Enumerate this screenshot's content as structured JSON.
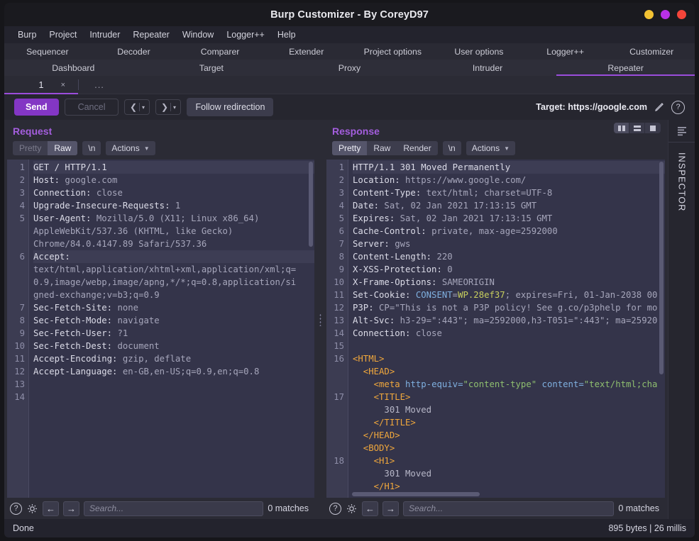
{
  "window": {
    "title": "Burp Customizer - By CoreyD97",
    "buttons": [
      {
        "name": "minimize",
        "color": "#f2c233"
      },
      {
        "name": "maximize",
        "color": "#b830e8"
      },
      {
        "name": "close",
        "color": "#f4453a"
      }
    ]
  },
  "menubar": {
    "items": [
      "Burp",
      "Project",
      "Intruder",
      "Repeater",
      "Window",
      "Logger++",
      "Help"
    ]
  },
  "nav": {
    "row1": [
      "Sequencer",
      "Decoder",
      "Comparer",
      "Extender",
      "Project options",
      "User options",
      "Logger++",
      "Customizer"
    ],
    "row2": [
      "Dashboard",
      "Target",
      "Proxy",
      "Intruder",
      "Repeater"
    ],
    "active_row2": "Repeater"
  },
  "repeater_tabs": {
    "tabs": [
      {
        "label": "1",
        "close": "×",
        "active": true
      }
    ],
    "more": "..."
  },
  "toolbar": {
    "send_label": "Send",
    "cancel_label": "Cancel",
    "back_caret": "▾",
    "forward_caret": "▾",
    "follow_label": "Follow redirection",
    "target_label": "Target: https://google.com",
    "edit_icon": "pencil-icon",
    "help_icon": "?"
  },
  "request": {
    "title": "Request",
    "tabs": [
      {
        "label": "Pretty",
        "state": "dim"
      },
      {
        "label": "Raw",
        "state": "on"
      }
    ],
    "newline_chip": "\\n",
    "actions_chip": "Actions",
    "lines": [
      {
        "n": "1",
        "hl": true,
        "segs": [
          {
            "t": "GET / HTTP/1.1",
            "c": "hk"
          }
        ]
      },
      {
        "n": "2",
        "hl": false,
        "segs": [
          {
            "t": "Host: ",
            "c": "hk"
          },
          {
            "t": "google.com",
            "c": "hv"
          }
        ]
      },
      {
        "n": "3",
        "hl": false,
        "segs": [
          {
            "t": "Connection: ",
            "c": "hk"
          },
          {
            "t": "close",
            "c": "hv"
          }
        ]
      },
      {
        "n": "4",
        "hl": false,
        "segs": [
          {
            "t": "Upgrade-Insecure-Requests: ",
            "c": "hk"
          },
          {
            "t": "1",
            "c": "hv"
          }
        ]
      },
      {
        "n": "5",
        "hl": false,
        "segs": [
          {
            "t": "User-Agent: ",
            "c": "hk"
          },
          {
            "t": "Mozilla/5.0 (X11; Linux x86_64)",
            "c": "hv"
          }
        ]
      },
      {
        "n": "",
        "hl": false,
        "segs": [
          {
            "t": "AppleWebKit/537.36 (KHTML, like Gecko)",
            "c": "hv"
          }
        ]
      },
      {
        "n": "",
        "hl": false,
        "segs": [
          {
            "t": "Chrome/84.0.4147.89 Safari/537.36",
            "c": "hv"
          }
        ]
      },
      {
        "n": "6",
        "hl": true,
        "segs": [
          {
            "t": "Accept:",
            "c": "hk"
          }
        ]
      },
      {
        "n": "",
        "hl": false,
        "segs": [
          {
            "t": "text/html,application/xhtml+xml,application/xml;q=",
            "c": "hv"
          }
        ]
      },
      {
        "n": "",
        "hl": false,
        "segs": [
          {
            "t": "0.9,image/webp,image/apng,*/*;q=0.8,application/si",
            "c": "hv"
          }
        ]
      },
      {
        "n": "",
        "hl": false,
        "segs": [
          {
            "t": "gned-exchange;v=b3;q=0.9",
            "c": "hv"
          }
        ]
      },
      {
        "n": "7",
        "hl": false,
        "segs": [
          {
            "t": "Sec-Fetch-Site: ",
            "c": "hk"
          },
          {
            "t": "none",
            "c": "hv"
          }
        ]
      },
      {
        "n": "8",
        "hl": false,
        "segs": [
          {
            "t": "Sec-Fetch-Mode: ",
            "c": "hk"
          },
          {
            "t": "navigate",
            "c": "hv"
          }
        ]
      },
      {
        "n": "9",
        "hl": false,
        "segs": [
          {
            "t": "Sec-Fetch-User: ",
            "c": "hk"
          },
          {
            "t": "?1",
            "c": "hv"
          }
        ]
      },
      {
        "n": "10",
        "hl": false,
        "segs": [
          {
            "t": "Sec-Fetch-Dest: ",
            "c": "hk"
          },
          {
            "t": "document",
            "c": "hv"
          }
        ]
      },
      {
        "n": "11",
        "hl": false,
        "segs": [
          {
            "t": "Accept-Encoding: ",
            "c": "hk"
          },
          {
            "t": "gzip, deflate",
            "c": "hv"
          }
        ]
      },
      {
        "n": "12",
        "hl": false,
        "segs": [
          {
            "t": "Accept-Language: ",
            "c": "hk"
          },
          {
            "t": "en-GB,en-US;q=0.9,en;q=0.8",
            "c": "hv"
          }
        ]
      },
      {
        "n": "13",
        "hl": false,
        "segs": [
          {
            "t": "",
            "c": "hv"
          }
        ]
      },
      {
        "n": "14",
        "hl": false,
        "segs": [
          {
            "t": "",
            "c": "hv"
          }
        ]
      }
    ],
    "search_placeholder": "Search...",
    "matches": "0 matches"
  },
  "response": {
    "title": "Response",
    "tabs": [
      {
        "label": "Pretty",
        "state": "on"
      },
      {
        "label": "Raw",
        "state": "off"
      },
      {
        "label": "Render",
        "state": "off"
      }
    ],
    "newline_chip": "\\n",
    "actions_chip": "Actions",
    "layout_buttons": [
      "split-vertical-icon",
      "split-horizontal-icon",
      "single-pane-icon"
    ],
    "layout_selected": 0,
    "lines": [
      {
        "n": "1",
        "hl": true,
        "segs": [
          {
            "t": "HTTP/1.1 301 Moved Permanently",
            "c": "hk"
          }
        ]
      },
      {
        "n": "2",
        "hl": false,
        "segs": [
          {
            "t": "Location: ",
            "c": "hk"
          },
          {
            "t": "https://www.google.com/",
            "c": "hv"
          }
        ]
      },
      {
        "n": "3",
        "hl": false,
        "segs": [
          {
            "t": "Content-Type: ",
            "c": "hk"
          },
          {
            "t": "text/html; charset=UTF-8",
            "c": "hv"
          }
        ]
      },
      {
        "n": "4",
        "hl": false,
        "segs": [
          {
            "t": "Date: ",
            "c": "hk"
          },
          {
            "t": "Sat, 02 Jan 2021 17:13:15 GMT",
            "c": "hv"
          }
        ]
      },
      {
        "n": "5",
        "hl": false,
        "segs": [
          {
            "t": "Expires: ",
            "c": "hk"
          },
          {
            "t": "Sat, 02 Jan 2021 17:13:15 GMT",
            "c": "hv"
          }
        ]
      },
      {
        "n": "6",
        "hl": false,
        "segs": [
          {
            "t": "Cache-Control: ",
            "c": "hk"
          },
          {
            "t": "private, max-age=2592000",
            "c": "hv"
          }
        ]
      },
      {
        "n": "7",
        "hl": false,
        "segs": [
          {
            "t": "Server: ",
            "c": "hk"
          },
          {
            "t": "gws",
            "c": "hv"
          }
        ]
      },
      {
        "n": "8",
        "hl": false,
        "segs": [
          {
            "t": "Content-Length: ",
            "c": "hk"
          },
          {
            "t": "220",
            "c": "hv"
          }
        ]
      },
      {
        "n": "9",
        "hl": false,
        "segs": [
          {
            "t": "X-XSS-Protection: ",
            "c": "hk"
          },
          {
            "t": "0",
            "c": "hv"
          }
        ]
      },
      {
        "n": "10",
        "hl": false,
        "segs": [
          {
            "t": "X-Frame-Options: ",
            "c": "hk"
          },
          {
            "t": "SAMEORIGIN",
            "c": "hv"
          }
        ]
      },
      {
        "n": "11",
        "hl": false,
        "segs": [
          {
            "t": "Set-Cookie: ",
            "c": "hk"
          },
          {
            "t": "CONSENT",
            "c": "ck"
          },
          {
            "t": "=",
            "c": "hv"
          },
          {
            "t": "WP.28ef37",
            "c": "cv"
          },
          {
            "t": "; expires=Fri, 01-Jan-2038 00",
            "c": "hv"
          }
        ]
      },
      {
        "n": "12",
        "hl": false,
        "segs": [
          {
            "t": "P3P: ",
            "c": "hk"
          },
          {
            "t": "CP=\"This is not a P3P policy! See g.co/p3phelp for mo",
            "c": "hv"
          }
        ]
      },
      {
        "n": "13",
        "hl": false,
        "segs": [
          {
            "t": "Alt-Svc: ",
            "c": "hk"
          },
          {
            "t": "h3-29=\":443\"; ma=2592000,h3-T051=\":443\"; ma=25920",
            "c": "hv"
          }
        ]
      },
      {
        "n": "14",
        "hl": false,
        "segs": [
          {
            "t": "Connection: ",
            "c": "hk"
          },
          {
            "t": "close",
            "c": "hv"
          }
        ]
      },
      {
        "n": "15",
        "hl": false,
        "segs": [
          {
            "t": "",
            "c": "hv"
          }
        ]
      },
      {
        "n": "16",
        "hl": false,
        "segs": [
          {
            "t": "<HTML>",
            "c": "tag"
          }
        ]
      },
      {
        "n": "",
        "hl": false,
        "segs": [
          {
            "t": "  <HEAD>",
            "c": "tag"
          }
        ]
      },
      {
        "n": "",
        "hl": false,
        "segs": [
          {
            "t": "    <meta ",
            "c": "tag"
          },
          {
            "t": "http-equiv=",
            "c": "attr"
          },
          {
            "t": "\"content-type\"",
            "c": "aval"
          },
          {
            "t": " content=",
            "c": "attr"
          },
          {
            "t": "\"text/html;cha",
            "c": "aval"
          }
        ]
      },
      {
        "n": "17",
        "hl": false,
        "segs": [
          {
            "t": "    <TITLE>",
            "c": "tag"
          }
        ]
      },
      {
        "n": "",
        "hl": false,
        "segs": [
          {
            "t": "      301 Moved",
            "c": "txt"
          }
        ]
      },
      {
        "n": "",
        "hl": false,
        "segs": [
          {
            "t": "    </TITLE>",
            "c": "tag"
          }
        ]
      },
      {
        "n": "",
        "hl": false,
        "segs": [
          {
            "t": "  </HEAD>",
            "c": "tag"
          }
        ]
      },
      {
        "n": "",
        "hl": false,
        "segs": [
          {
            "t": "  <BODY>",
            "c": "tag"
          }
        ]
      },
      {
        "n": "18",
        "hl": false,
        "segs": [
          {
            "t": "    <H1>",
            "c": "tag"
          }
        ]
      },
      {
        "n": "",
        "hl": false,
        "segs": [
          {
            "t": "      301 Moved",
            "c": "txt"
          }
        ]
      },
      {
        "n": "",
        "hl": false,
        "segs": [
          {
            "t": "    </H1>",
            "c": "tag"
          }
        ]
      }
    ],
    "search_placeholder": "Search...",
    "matches": "0 matches"
  },
  "inspector": {
    "label": "INSPECTOR",
    "icon": "hamburger-lines-icon"
  },
  "statusbar": {
    "left": "Done",
    "right": "895 bytes | 26 millis"
  },
  "colors": {
    "accent": "#9b4ddb",
    "send_button": "#8336c4",
    "pane_title": "#a45ede",
    "editor_bg": "#34344a",
    "window_bg": "#26262f"
  }
}
